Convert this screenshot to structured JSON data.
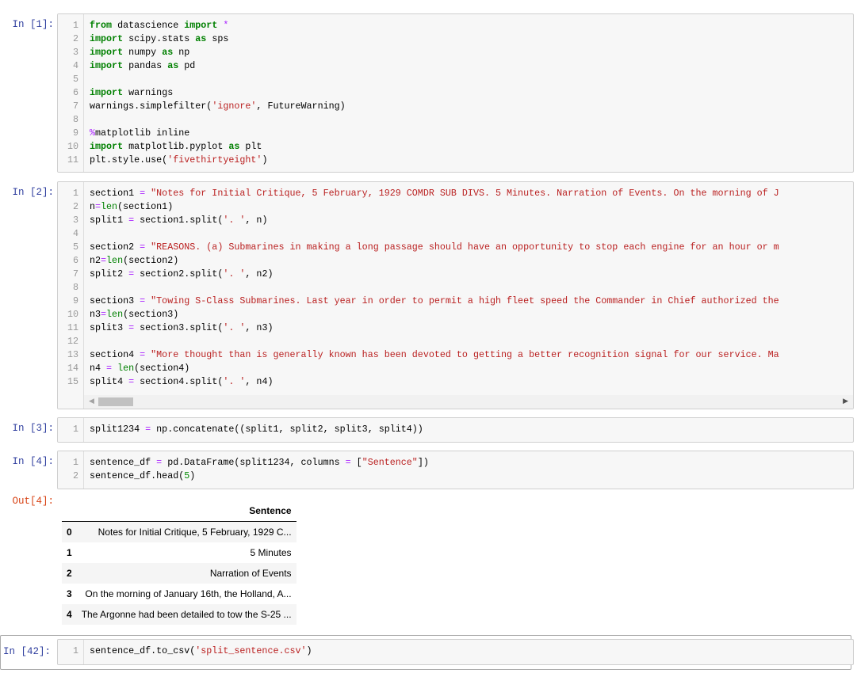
{
  "cells": [
    {
      "prompt": "In [1]:",
      "lines": [
        [
          [
            "from",
            "k"
          ],
          [
            " datascience ",
            "p"
          ],
          [
            "import",
            "k"
          ],
          [
            " ",
            "p"
          ],
          [
            "*",
            "o"
          ]
        ],
        [
          [
            "import",
            "k"
          ],
          [
            " scipy.stats ",
            "p"
          ],
          [
            "as",
            "k"
          ],
          [
            " sps",
            "p"
          ]
        ],
        [
          [
            "import",
            "k"
          ],
          [
            " numpy ",
            "p"
          ],
          [
            "as",
            "k"
          ],
          [
            " np",
            "p"
          ]
        ],
        [
          [
            "import",
            "k"
          ],
          [
            " pandas ",
            "p"
          ],
          [
            "as",
            "k"
          ],
          [
            " pd",
            "p"
          ]
        ],
        [],
        [
          [
            "import",
            "k"
          ],
          [
            " warnings",
            "p"
          ]
        ],
        [
          [
            "warnings.simplefilter(",
            "p"
          ],
          [
            "'ignore'",
            "s"
          ],
          [
            ", FutureWarning)",
            "p"
          ]
        ],
        [],
        [
          [
            "%",
            "o"
          ],
          [
            "matplotlib inline",
            "p"
          ]
        ],
        [
          [
            "import",
            "k"
          ],
          [
            " matplotlib.pyplot ",
            "p"
          ],
          [
            "as",
            "k"
          ],
          [
            " plt",
            "p"
          ]
        ],
        [
          [
            "plt.style.use(",
            "p"
          ],
          [
            "'fivethirtyeight'",
            "s"
          ],
          [
            ")",
            "p"
          ]
        ]
      ]
    },
    {
      "prompt": "In [2]:",
      "lines": [
        [
          [
            "section1 ",
            "p"
          ],
          [
            "=",
            "o"
          ],
          [
            " ",
            "p"
          ],
          [
            "\"Notes for Initial Critique, 5 February, 1929 COMDR SUB DIVS. 5 Minutes. Narration of Events. On the morning of J",
            "s"
          ]
        ],
        [
          [
            "n",
            "p"
          ],
          [
            "=",
            "o"
          ],
          [
            "len",
            "b"
          ],
          [
            "(section1)",
            "p"
          ]
        ],
        [
          [
            "split1 ",
            "p"
          ],
          [
            "=",
            "o"
          ],
          [
            " section1.split(",
            "p"
          ],
          [
            "'. '",
            "s"
          ],
          [
            ", n)",
            "p"
          ]
        ],
        [],
        [
          [
            "section2 ",
            "p"
          ],
          [
            "=",
            "o"
          ],
          [
            " ",
            "p"
          ],
          [
            "\"REASONS. (a) Submarines in making a long passage should have an opportunity to stop each engine for an hour or m",
            "s"
          ]
        ],
        [
          [
            "n2",
            "p"
          ],
          [
            "=",
            "o"
          ],
          [
            "len",
            "b"
          ],
          [
            "(section2)",
            "p"
          ]
        ],
        [
          [
            "split2 ",
            "p"
          ],
          [
            "=",
            "o"
          ],
          [
            " section2.split(",
            "p"
          ],
          [
            "'. '",
            "s"
          ],
          [
            ", n2)",
            "p"
          ]
        ],
        [],
        [
          [
            "section3 ",
            "p"
          ],
          [
            "=",
            "o"
          ],
          [
            " ",
            "p"
          ],
          [
            "\"Towing S-Class Submarines. Last year in order to permit a high fleet speed the Commander in Chief authorized the",
            "s"
          ]
        ],
        [
          [
            "n3",
            "p"
          ],
          [
            "=",
            "o"
          ],
          [
            "len",
            "b"
          ],
          [
            "(section3)",
            "p"
          ]
        ],
        [
          [
            "split3 ",
            "p"
          ],
          [
            "=",
            "o"
          ],
          [
            " section3.split(",
            "p"
          ],
          [
            "'. '",
            "s"
          ],
          [
            ", n3)",
            "p"
          ]
        ],
        [],
        [
          [
            "section4 ",
            "p"
          ],
          [
            "=",
            "o"
          ],
          [
            " ",
            "p"
          ],
          [
            "\"More thought than is generally known has been devoted to getting a better recognition signal for our service. Ma",
            "s"
          ]
        ],
        [
          [
            "n4 ",
            "p"
          ],
          [
            "=",
            "o"
          ],
          [
            " ",
            "p"
          ],
          [
            "len",
            "b"
          ],
          [
            "(section4)",
            "p"
          ]
        ],
        [
          [
            "split4 ",
            "p"
          ],
          [
            "=",
            "o"
          ],
          [
            " section4.split(",
            "p"
          ],
          [
            "'. '",
            "s"
          ],
          [
            ", n4)",
            "p"
          ]
        ]
      ]
    },
    {
      "prompt": "In [3]:",
      "lines": [
        [
          [
            "split1234 ",
            "p"
          ],
          [
            "=",
            "o"
          ],
          [
            " np.concatenate((split1, split2, split3, split4))",
            "p"
          ]
        ]
      ]
    },
    {
      "prompt": "In [4]:",
      "lines": [
        [
          [
            "sentence_df ",
            "p"
          ],
          [
            "=",
            "o"
          ],
          [
            " pd.DataFrame(split1234, columns ",
            "p"
          ],
          [
            "=",
            "o"
          ],
          [
            " [",
            "p"
          ],
          [
            "\"Sentence\"",
            "s"
          ],
          [
            "])",
            "p"
          ]
        ],
        [
          [
            "sentence_df.head(",
            "p"
          ],
          [
            "5",
            "n"
          ],
          [
            ")",
            "p"
          ]
        ]
      ]
    },
    {
      "prompt": "In [42]:",
      "lines": [
        [
          [
            "sentence_df.to_csv(",
            "p"
          ],
          [
            "'split_sentence.csv'",
            "s"
          ],
          [
            ")",
            "p"
          ]
        ]
      ]
    }
  ],
  "output": {
    "prompt": "Out[4]:",
    "columns": [
      "",
      "Sentence"
    ],
    "rows": [
      [
        "0",
        "Notes for Initial Critique, 5 February, 1929 C..."
      ],
      [
        "1",
        "5 Minutes"
      ],
      [
        "2",
        "Narration of Events"
      ],
      [
        "3",
        "On the morning of January 16th, the Holland, A..."
      ],
      [
        "4",
        "The Argonne had been detailed to tow the S-25 ..."
      ]
    ]
  },
  "colors": {
    "keyword": "#008000",
    "string": "#BA2121",
    "operator": "#AA22FF",
    "in_prompt": "#303F9F",
    "out_prompt": "#D84315"
  }
}
